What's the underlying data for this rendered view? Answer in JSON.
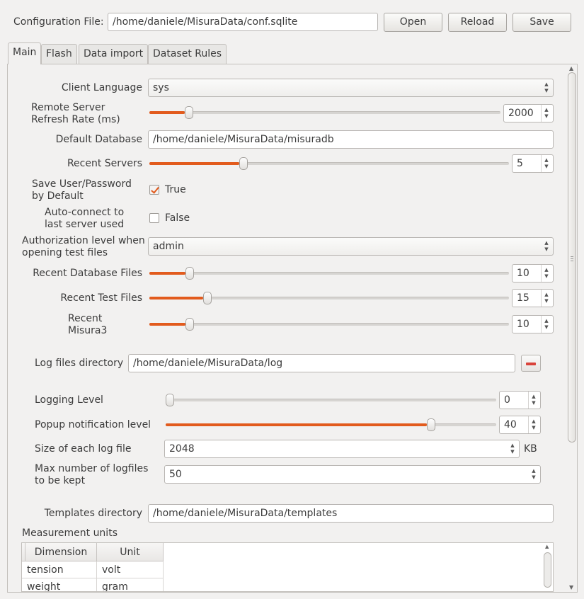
{
  "header": {
    "config_label": "Configuration File:",
    "config_path": "/home/daniele/MisuraData/conf.sqlite",
    "open_label": "Open",
    "reload_label": "Reload",
    "save_label": "Save"
  },
  "tabs": [
    {
      "label": "Main",
      "active": true
    },
    {
      "label": "Flash"
    },
    {
      "label": "Data import"
    },
    {
      "label": "Dataset Rules"
    }
  ],
  "main": {
    "client_language": {
      "label": "Client Language",
      "value": "sys"
    },
    "refresh_rate": {
      "label": "Remote Server Refresh Rate (ms)",
      "value": "2000",
      "slider_fraction": 0.1
    },
    "default_db": {
      "label": "Default Database",
      "value": "/home/daniele/MisuraData/misuradb"
    },
    "recent_servers": {
      "label": "Recent Servers",
      "value": "5",
      "slider_fraction": 0.25
    },
    "save_user": {
      "label": "Save User/Password by Default",
      "checked": true,
      "text": "True"
    },
    "auto_connect": {
      "label": "Auto-connect to last server used",
      "checked": false,
      "text": "False"
    },
    "auth_level": {
      "label": "Authorization level when opening test files",
      "value": "admin"
    },
    "recent_db_files": {
      "label": "Recent Database Files",
      "value": "10",
      "slider_fraction": 0.1
    },
    "recent_test_files": {
      "label": "Recent Test Files",
      "value": "15",
      "slider_fraction": 0.15
    },
    "recent_misura3": {
      "label": "Recent Misura3",
      "value": "10",
      "slider_fraction": 0.1
    },
    "log_dir": {
      "label": "Log files directory",
      "value": "/home/daniele/MisuraData/log"
    },
    "logging_level": {
      "label": "Logging Level",
      "value": "0",
      "slider_fraction": 0.0
    },
    "popup_level": {
      "label": "Popup notification level",
      "value": "40",
      "slider_fraction": 0.79
    },
    "log_size": {
      "label": "Size of each log file",
      "value": "2048",
      "unit": "KB"
    },
    "max_logfiles": {
      "label": "Max number of logfiles to be kept",
      "value": "50"
    },
    "templates_dir": {
      "label": "Templates directory",
      "value": "/home/daniele/MisuraData/templates"
    },
    "units": {
      "label": "Measurement units",
      "headers": [
        "Dimension",
        "Unit"
      ],
      "rows": [
        {
          "dimension": "tension",
          "unit": "volt"
        },
        {
          "dimension": "weight",
          "unit": "gram"
        }
      ]
    }
  },
  "colors": {
    "accent": "#e25b1d",
    "background": "#f2f1f0"
  }
}
